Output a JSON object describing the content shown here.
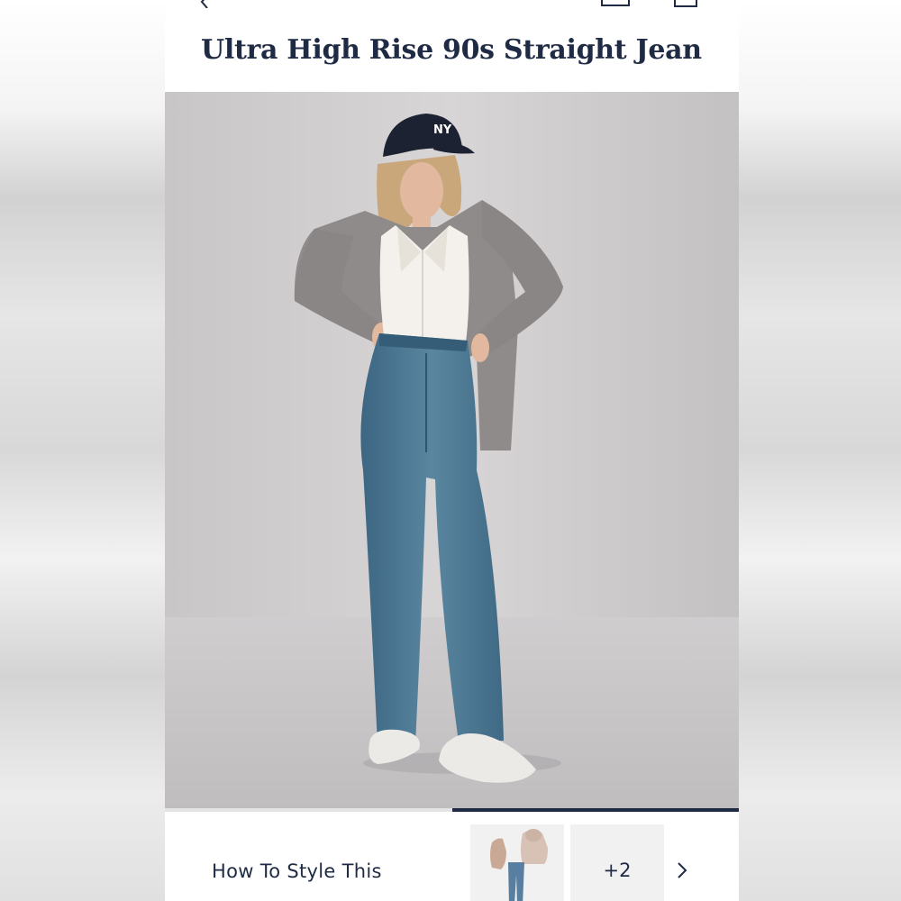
{
  "product": {
    "title": "Ultra High Rise 90s Straight Jean"
  },
  "header": {
    "back_icon": "chevron-left-icon",
    "account_icon": "account-icon",
    "bag_icon": "shopping-bag-icon"
  },
  "gallery": {
    "image_description": "product-photo",
    "progress_fraction": 0.5
  },
  "style_section": {
    "label": "How To Style This",
    "more_count": "+2",
    "next_icon": "chevron-right-icon"
  },
  "colors": {
    "title_navy": "#1f2b44",
    "progress_navy": "#1f2b44"
  }
}
